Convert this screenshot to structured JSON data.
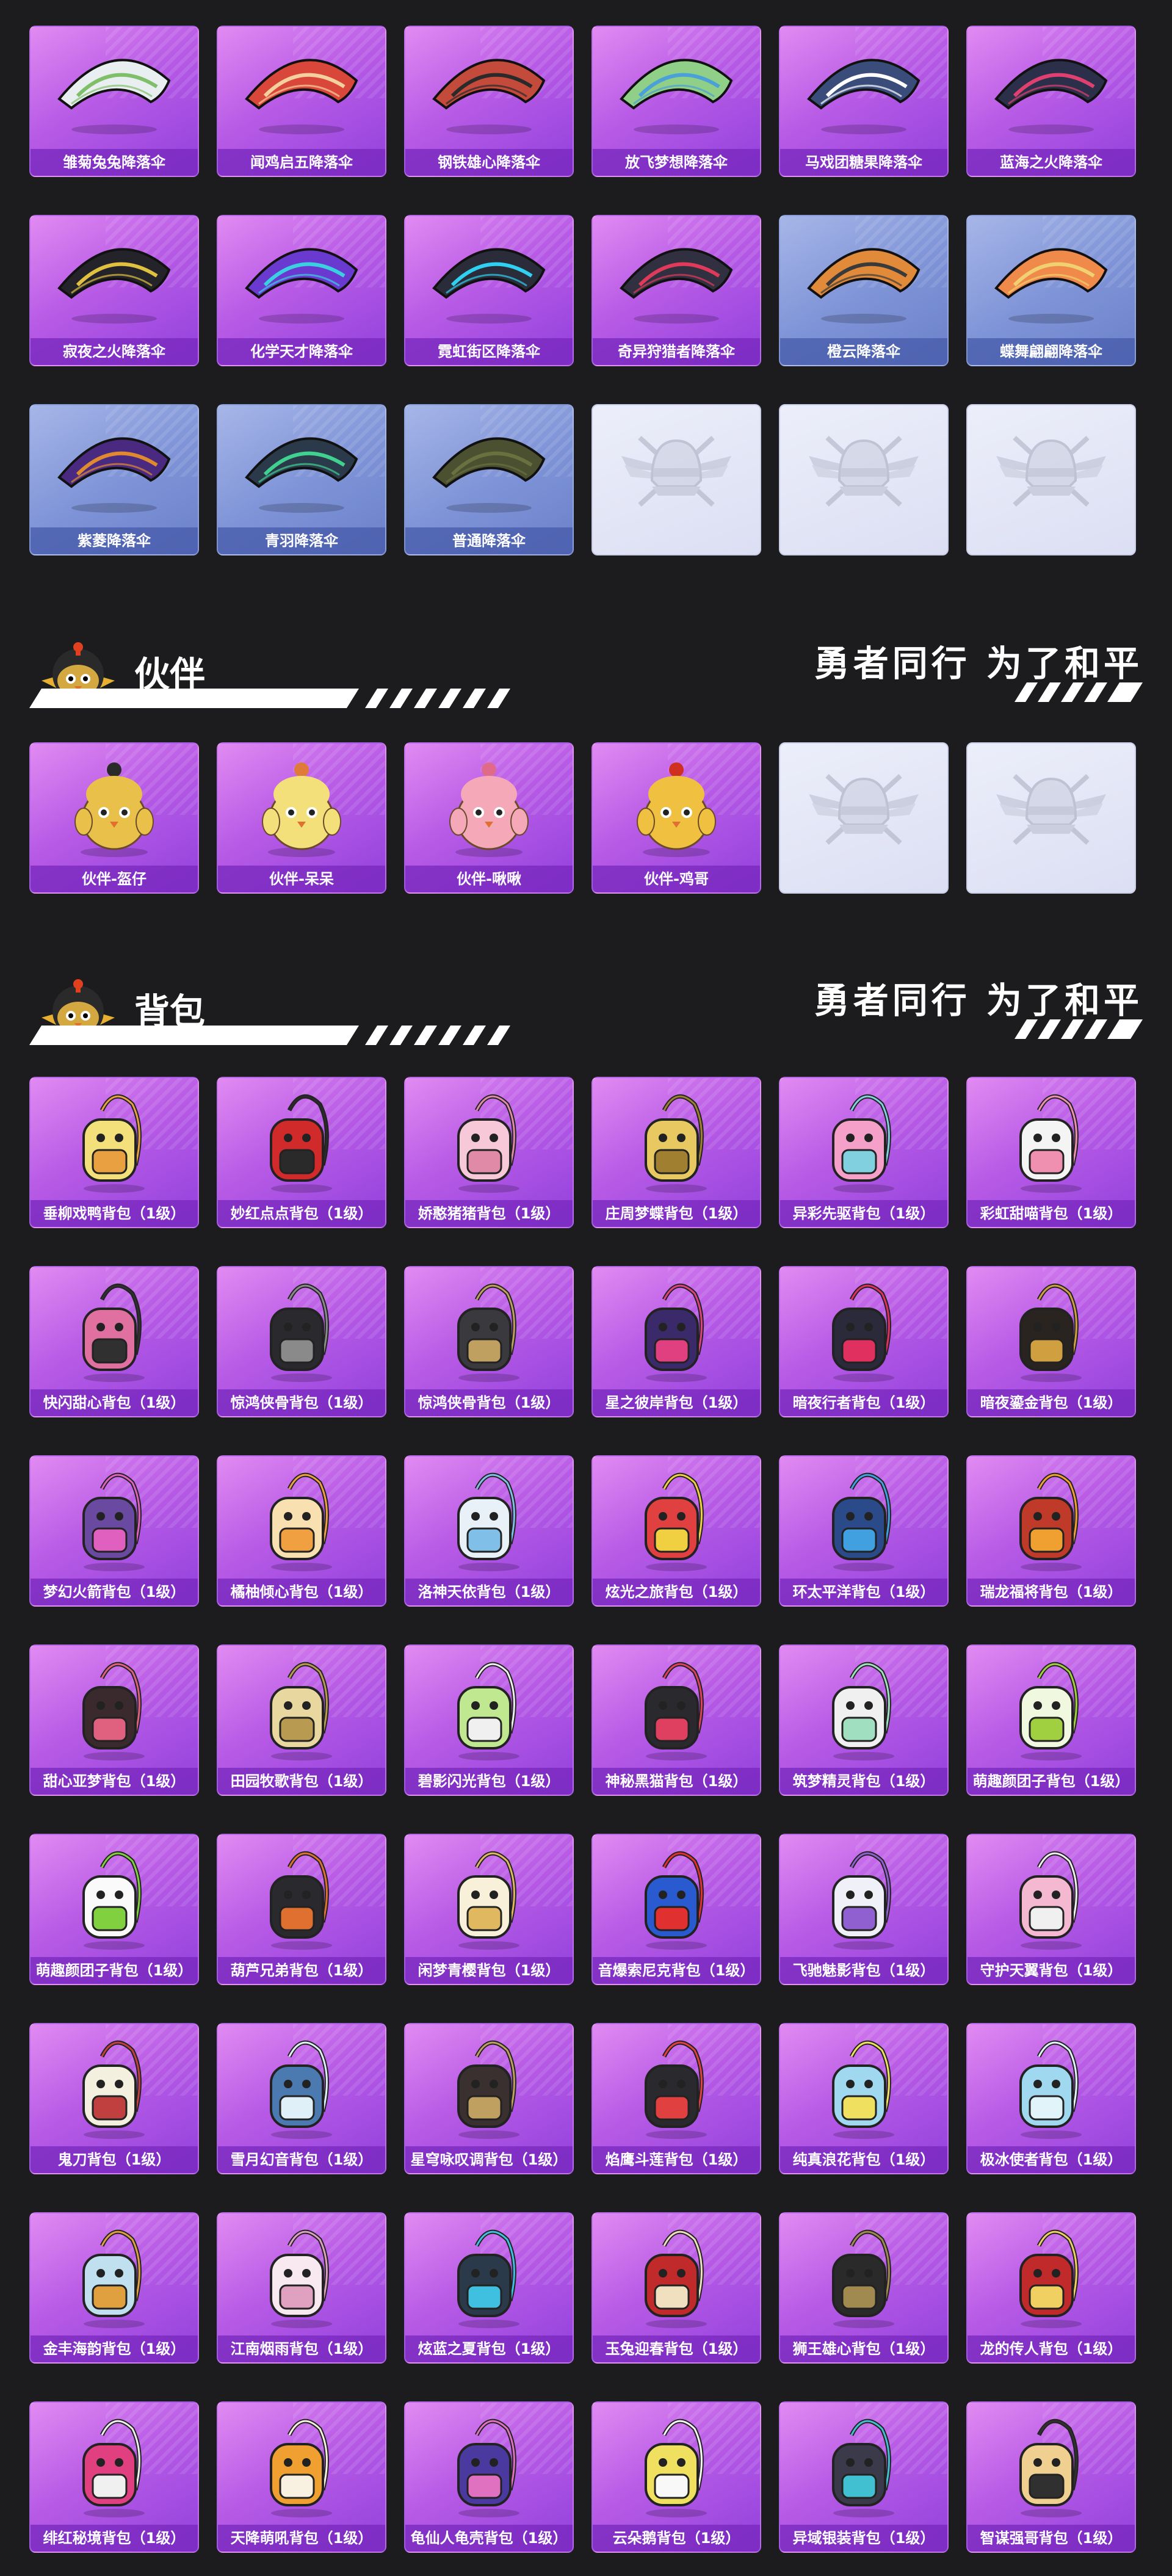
{
  "sections": {
    "partner": {
      "title": "伙伴",
      "slogan": "勇者同行 为了和平"
    },
    "backpack": {
      "title": "背包",
      "slogan": "勇者同行 为了和平"
    }
  },
  "parachutes": [
    {
      "label": "雏菊兔兔降落伞",
      "style": "purple",
      "color": "#e9eef0",
      "accent": "#7fbf6a"
    },
    {
      "label": "闻鸡启五降落伞",
      "style": "purple",
      "color": "#d9473a",
      "accent": "#f4d0a0"
    },
    {
      "label": "钢铁雄心降落伞",
      "style": "purple",
      "color": "#c44a3c",
      "accent": "#2a2a2a"
    },
    {
      "label": "放飞梦想降落伞",
      "style": "purple",
      "color": "#8fcf88",
      "accent": "#4aa0d8"
    },
    {
      "label": "马戏团糖果降落伞",
      "style": "purple",
      "color": "#3a4d7a",
      "accent": "#ffffff"
    },
    {
      "label": "蓝海之火降落伞",
      "style": "purple",
      "color": "#2c2f4a",
      "accent": "#e04070"
    },
    {
      "label": "寂夜之火降落伞",
      "style": "purple",
      "color": "#24232a",
      "accent": "#e0c040"
    },
    {
      "label": "化学天才降落伞",
      "style": "purple",
      "color": "#6a3ad0",
      "accent": "#3ad0e0"
    },
    {
      "label": "霓虹街区降落伞",
      "style": "purple",
      "color": "#2a2c3a",
      "accent": "#30d0f0"
    },
    {
      "label": "奇异狩猎者降落伞",
      "style": "purple",
      "color": "#303040",
      "accent": "#e03a5a"
    },
    {
      "label": "橙云降落伞",
      "style": "blue",
      "color": "#e08a3a",
      "accent": "#3a3a3a"
    },
    {
      "label": "蝶舞翩翩降落伞",
      "style": "blue",
      "color": "#f08a4a",
      "accent": "#f0d070"
    },
    {
      "label": "紫菱降落伞",
      "style": "blue",
      "color": "#4a2a80",
      "accent": "#e08a30"
    },
    {
      "label": "青羽降落伞",
      "style": "blue",
      "color": "#2a3a4a",
      "accent": "#40d090"
    },
    {
      "label": "普通降落伞",
      "style": "blue",
      "color": "#4a5030",
      "accent": "#6a7040"
    }
  ],
  "parachute_empty_count": 3,
  "partners": [
    {
      "label": "伙伴-盔仔",
      "color": "#e8c04a",
      "accent": "#2a2a2a"
    },
    {
      "label": "伙伴-呆呆",
      "color": "#f4e07a",
      "accent": "#e07a3a"
    },
    {
      "label": "伙伴-啾啾",
      "color": "#f4a8b8",
      "accent": "#e06a8a"
    },
    {
      "label": "伙伴-鸡哥",
      "color": "#f0c040",
      "accent": "#d03020"
    }
  ],
  "partner_empty_count": 2,
  "backpacks": [
    {
      "label": "垂柳戏鸭背包（1级）",
      "color": "#f4e07a",
      "accent": "#e8a040"
    },
    {
      "label": "妙红点点背包（1级）",
      "color": "#d02a2a",
      "accent": "#2a2a2a"
    },
    {
      "label": "娇憨猪猪背包（1级）",
      "color": "#f6c8d8",
      "accent": "#e08aa8"
    },
    {
      "label": "庄周梦蝶背包（1级）",
      "color": "#e8c860",
      "accent": "#a08030"
    },
    {
      "label": "异彩先驱背包（1级）",
      "color": "#f4a0c8",
      "accent": "#80d0e0"
    },
    {
      "label": "彩虹甜喵背包（1级）",
      "color": "#f4f4f4",
      "accent": "#f090b0"
    },
    {
      "label": "快闪甜心背包（1级）",
      "color": "#e070a0",
      "accent": "#303030"
    },
    {
      "label": "惊鸿侠骨背包（1级）",
      "color": "#2a2a2e",
      "accent": "#8a8a8a"
    },
    {
      "label": "惊鸿侠骨背包（1级）",
      "color": "#3a3a3e",
      "accent": "#c0a060"
    },
    {
      "label": "星之彼岸背包（1级）",
      "color": "#3a2a6a",
      "accent": "#e04080"
    },
    {
      "label": "暗夜行者背包（1级）",
      "color": "#2a2a3a",
      "accent": "#e03060"
    },
    {
      "label": "暗夜鎏金背包（1级）",
      "color": "#2a2420",
      "accent": "#d0a040"
    },
    {
      "label": "梦幻火箭背包（1级）",
      "color": "#6a4aa0",
      "accent": "#e060c0"
    },
    {
      "label": "橘柚倾心背包（1级）",
      "color": "#f8e0b0",
      "accent": "#f0a040"
    },
    {
      "label": "洛神天依背包（1级）",
      "color": "#e8f0f8",
      "accent": "#80c0e8"
    },
    {
      "label": "炫光之旅背包（1级）",
      "color": "#e04040",
      "accent": "#f0d040"
    },
    {
      "label": "环太平洋背包（1级）",
      "color": "#2a4a8a",
      "accent": "#40a0e0"
    },
    {
      "label": "瑞龙福将背包（1级）",
      "color": "#c03a2a",
      "accent": "#f0a030"
    },
    {
      "label": "甜心亚梦背包（1级）",
      "color": "#3a2a2e",
      "accent": "#e06080"
    },
    {
      "label": "田园牧歌背包（1级）",
      "color": "#e8d8a0",
      "accent": "#b89a50"
    },
    {
      "label": "碧影闪光背包（1级）",
      "color": "#c0e890",
      "accent": "#f0f0f0"
    },
    {
      "label": "神秘黑猫背包（1级）",
      "color": "#2a2a2e",
      "accent": "#e04060"
    },
    {
      "label": "筑梦精灵背包（1级）",
      "color": "#f0f0f0",
      "accent": "#a0e0c0"
    },
    {
      "label": "萌趣颜团子背包（1级）",
      "color": "#f0f8e0",
      "accent": "#a0d040"
    },
    {
      "label": "萌趣颜团子背包（1级）",
      "color": "#fafafa",
      "accent": "#80d040"
    },
    {
      "label": "葫芦兄弟背包（1级）",
      "color": "#2a2a2e",
      "accent": "#e07030"
    },
    {
      "label": "闲梦青樱背包（1级）",
      "color": "#f8f0d8",
      "accent": "#e0b860"
    },
    {
      "label": "音爆索尼克背包（1级）",
      "color": "#2a5ad0",
      "accent": "#e03030"
    },
    {
      "label": "飞驰魅影背包（1级）",
      "color": "#f0f0f8",
      "accent": "#9060d0"
    },
    {
      "label": "守护天翼背包（1级）",
      "color": "#f4b8d0",
      "accent": "#f0f0f0"
    },
    {
      "label": "鬼刀背包（1级）",
      "color": "#f4f0e0",
      "accent": "#c04040"
    },
    {
      "label": "雪月幻音背包（1级）",
      "color": "#4a7ab0",
      "accent": "#e0f0f8"
    },
    {
      "label": "星穹咏叹调背包（1级）",
      "color": "#3a3030",
      "accent": "#c0a060"
    },
    {
      "label": "焰鹰斗莲背包（1级）",
      "color": "#2a2a2e",
      "accent": "#e04040"
    },
    {
      "label": "纯真浪花背包（1级）",
      "color": "#a0d8f0",
      "accent": "#f0e060"
    },
    {
      "label": "极冰使者背包（1级）",
      "color": "#a0d8f0",
      "accent": "#e0f4fa"
    },
    {
      "label": "金丰海韵背包（1级）",
      "color": "#c0e0f0",
      "accent": "#e0a040"
    },
    {
      "label": "江南烟雨背包（1级）",
      "color": "#f8e8f0",
      "accent": "#e0a0c0"
    },
    {
      "label": "炫蓝之夏背包（1级）",
      "color": "#2a3a4a",
      "accent": "#40c0e0"
    },
    {
      "label": "玉兔迎春背包（1级）",
      "color": "#c02a2a",
      "accent": "#f0e0c0"
    },
    {
      "label": "狮王雄心背包（1级）",
      "color": "#2a2a2a",
      "accent": "#a08a50"
    },
    {
      "label": "龙的传人背包（1级）",
      "color": "#c02a2a",
      "accent": "#f0d060"
    },
    {
      "label": "绯红秘境背包（1级）",
      "color": "#e04080",
      "accent": "#f0f0f0"
    },
    {
      "label": "天降萌吼背包（1级）",
      "color": "#f0a030",
      "accent": "#f8f0e0"
    },
    {
      "label": "龟仙人龟壳背包（1级）",
      "color": "#4a3aa0",
      "accent": "#e070c0"
    },
    {
      "label": "云朵鹅背包（1级）",
      "color": "#f0e060",
      "accent": "#f8f8f8"
    },
    {
      "label": "异域银装背包（1级）",
      "color": "#3a3a4a",
      "accent": "#40c0d0"
    },
    {
      "label": "智谋强哥背包（1级）",
      "color": "#f0d090",
      "accent": "#303030"
    }
  ]
}
